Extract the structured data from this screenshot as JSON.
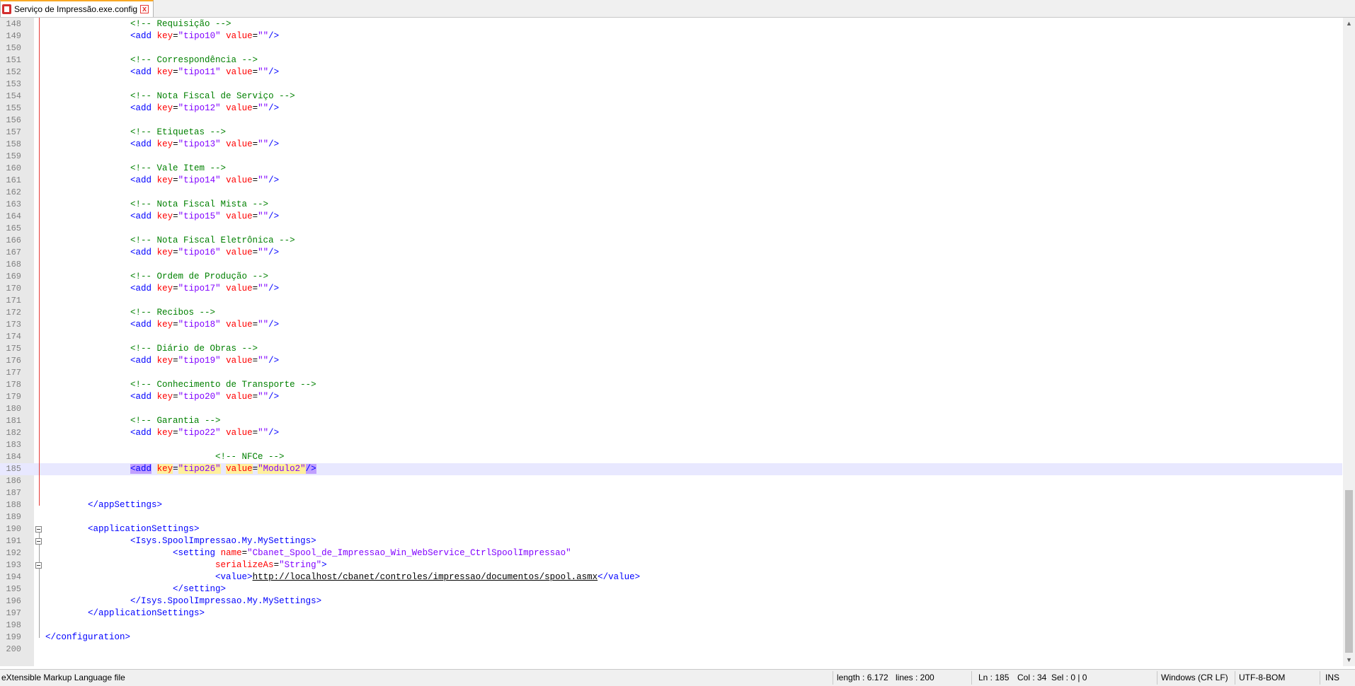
{
  "tab": {
    "title": "Serviço de Impressão.exe.config",
    "close_label": "x"
  },
  "editor": {
    "lines": [
      {
        "n": "148",
        "html": "    <span class='c-comment'>&lt;!-- Requisição --&gt;</span>"
      },
      {
        "n": "149",
        "html": "    <span class='c-tag'>&lt;add</span> <span class='c-attr'>key</span><span class='c-text'>=</span><span class='c-val'>\"tipo10\"</span> <span class='c-attr'>value</span><span class='c-text'>=</span><span class='c-val'>\"\"</span><span class='c-tag'>/&gt;</span>"
      },
      {
        "n": "150",
        "html": ""
      },
      {
        "n": "151",
        "html": "    <span class='c-comment'>&lt;!-- Correspondência --&gt;</span>"
      },
      {
        "n": "152",
        "html": "    <span class='c-tag'>&lt;add</span> <span class='c-attr'>key</span><span class='c-text'>=</span><span class='c-val'>\"tipo11\"</span> <span class='c-attr'>value</span><span class='c-text'>=</span><span class='c-val'>\"\"</span><span class='c-tag'>/&gt;</span>"
      },
      {
        "n": "153",
        "html": ""
      },
      {
        "n": "154",
        "html": "    <span class='c-comment'>&lt;!-- Nota Fiscal de Serviço --&gt;</span>"
      },
      {
        "n": "155",
        "html": "    <span class='c-tag'>&lt;add</span> <span class='c-attr'>key</span><span class='c-text'>=</span><span class='c-val'>\"tipo12\"</span> <span class='c-attr'>value</span><span class='c-text'>=</span><span class='c-val'>\"\"</span><span class='c-tag'>/&gt;</span>"
      },
      {
        "n": "156",
        "html": ""
      },
      {
        "n": "157",
        "html": "    <span class='c-comment'>&lt;!-- Etiquetas --&gt;</span>"
      },
      {
        "n": "158",
        "html": "    <span class='c-tag'>&lt;add</span> <span class='c-attr'>key</span><span class='c-text'>=</span><span class='c-val'>\"tipo13\"</span> <span class='c-attr'>value</span><span class='c-text'>=</span><span class='c-val'>\"\"</span><span class='c-tag'>/&gt;</span>"
      },
      {
        "n": "159",
        "html": ""
      },
      {
        "n": "160",
        "html": "    <span class='c-comment'>&lt;!-- Vale Item --&gt;</span>"
      },
      {
        "n": "161",
        "html": "    <span class='c-tag'>&lt;add</span> <span class='c-attr'>key</span><span class='c-text'>=</span><span class='c-val'>\"tipo14\"</span> <span class='c-attr'>value</span><span class='c-text'>=</span><span class='c-val'>\"\"</span><span class='c-tag'>/&gt;</span>"
      },
      {
        "n": "162",
        "html": ""
      },
      {
        "n": "163",
        "html": "    <span class='c-comment'>&lt;!-- Nota Fiscal Mista --&gt;</span>"
      },
      {
        "n": "164",
        "html": "    <span class='c-tag'>&lt;add</span> <span class='c-attr'>key</span><span class='c-text'>=</span><span class='c-val'>\"tipo15\"</span> <span class='c-attr'>value</span><span class='c-text'>=</span><span class='c-val'>\"\"</span><span class='c-tag'>/&gt;</span>"
      },
      {
        "n": "165",
        "html": ""
      },
      {
        "n": "166",
        "html": "    <span class='c-comment'>&lt;!-- Nota Fiscal Eletrônica --&gt;</span>"
      },
      {
        "n": "167",
        "html": "    <span class='c-tag'>&lt;add</span> <span class='c-attr'>key</span><span class='c-text'>=</span><span class='c-val'>\"tipo16\"</span> <span class='c-attr'>value</span><span class='c-text'>=</span><span class='c-val'>\"\"</span><span class='c-tag'>/&gt;</span>"
      },
      {
        "n": "168",
        "html": ""
      },
      {
        "n": "169",
        "html": "    <span class='c-comment'>&lt;!-- Ordem de Produção --&gt;</span>"
      },
      {
        "n": "170",
        "html": "    <span class='c-tag'>&lt;add</span> <span class='c-attr'>key</span><span class='c-text'>=</span><span class='c-val'>\"tipo17\"</span> <span class='c-attr'>value</span><span class='c-text'>=</span><span class='c-val'>\"\"</span><span class='c-tag'>/&gt;</span>"
      },
      {
        "n": "171",
        "html": ""
      },
      {
        "n": "172",
        "html": "    <span class='c-comment'>&lt;!-- Recibos --&gt;</span>"
      },
      {
        "n": "173",
        "html": "    <span class='c-tag'>&lt;add</span> <span class='c-attr'>key</span><span class='c-text'>=</span><span class='c-val'>\"tipo18\"</span> <span class='c-attr'>value</span><span class='c-text'>=</span><span class='c-val'>\"\"</span><span class='c-tag'>/&gt;</span>"
      },
      {
        "n": "174",
        "html": ""
      },
      {
        "n": "175",
        "html": "    <span class='c-comment'>&lt;!-- Diário de Obras --&gt;</span>"
      },
      {
        "n": "176",
        "html": "    <span class='c-tag'>&lt;add</span> <span class='c-attr'>key</span><span class='c-text'>=</span><span class='c-val'>\"tipo19\"</span> <span class='c-attr'>value</span><span class='c-text'>=</span><span class='c-val'>\"\"</span><span class='c-tag'>/&gt;</span>"
      },
      {
        "n": "177",
        "html": ""
      },
      {
        "n": "178",
        "html": "    <span class='c-comment'>&lt;!-- Conhecimento de Transporte --&gt;</span>"
      },
      {
        "n": "179",
        "html": "    <span class='c-tag'>&lt;add</span> <span class='c-attr'>key</span><span class='c-text'>=</span><span class='c-val'>\"tipo20\"</span> <span class='c-attr'>value</span><span class='c-text'>=</span><span class='c-val'>\"\"</span><span class='c-tag'>/&gt;</span>"
      },
      {
        "n": "180",
        "html": ""
      },
      {
        "n": "181",
        "html": "    <span class='c-comment'>&lt;!-- Garantia --&gt;</span>"
      },
      {
        "n": "182",
        "html": "    <span class='c-tag'>&lt;add</span> <span class='c-attr'>key</span><span class='c-text'>=</span><span class='c-val'>\"tipo22\"</span> <span class='c-attr'>value</span><span class='c-text'>=</span><span class='c-val'>\"\"</span><span class='c-tag'>/&gt;</span>"
      },
      {
        "n": "183",
        "html": ""
      },
      {
        "n": "184",
        "html": "        <span class='c-comment'>&lt;!-- NFCe --&gt;</span>"
      },
      {
        "n": "185",
        "html": "    <span class='c-tag hl-tag'>&lt;add</span> <span class='c-attr hl-attr'>key</span><span class='c-text'>=</span><span class='c-val hl-attr'>\"tipo26\"</span> <span class='c-attr hl-attr'>value</span><span class='c-text'>=</span><span class='c-val hl-attr'>\"Modulo2\"</span><span class='c-tag hl-tag'>/&gt;</span>",
        "current": true
      },
      {
        "n": "186",
        "html": ""
      },
      {
        "n": "187",
        "html": ""
      },
      {
        "n": "188",
        "html": "  <span class='c-tag'>&lt;/appSettings&gt;</span>"
      },
      {
        "n": "189",
        "html": ""
      },
      {
        "n": "190",
        "html": "  <span class='c-tag'>&lt;applicationSettings&gt;</span>"
      },
      {
        "n": "191",
        "html": "    <span class='c-tag'>&lt;Isys.SpoolImpressao.My.MySettings&gt;</span>"
      },
      {
        "n": "192",
        "html": "      <span class='c-tag'>&lt;setting</span> <span class='c-attr'>name</span><span class='c-text'>=</span><span class='c-val'>\"Cbanet_Spool_de_Impressao_Win_WebService_CtrlSpoolImpressao\"</span>"
      },
      {
        "n": "193",
        "html": "        <span class='c-attr'>serializeAs</span><span class='c-text'>=</span><span class='c-val'>\"String\"</span><span class='c-tag'>&gt;</span>"
      },
      {
        "n": "194",
        "html": "        <span class='c-tag'>&lt;value&gt;</span><span class='c-url'>http://localhost/cbanet/controles/impressao/documentos/spool.asmx</span><span class='c-tag'>&lt;/value&gt;</span>"
      },
      {
        "n": "195",
        "html": "      <span class='c-tag'>&lt;/setting&gt;</span>"
      },
      {
        "n": "196",
        "html": "    <span class='c-tag'>&lt;/Isys.SpoolImpressao.My.MySettings&gt;</span>"
      },
      {
        "n": "197",
        "html": "  <span class='c-tag'>&lt;/applicationSettings&gt;</span>"
      },
      {
        "n": "198",
        "html": ""
      },
      {
        "n": "199",
        "html": "<span class='c-tag'>&lt;/configuration&gt;</span>"
      },
      {
        "n": "200",
        "html": ""
      }
    ]
  },
  "status": {
    "file_type": "eXtensible Markup Language file",
    "length": "length : 6.172",
    "lines": "lines : 200",
    "ln": "Ln : 185",
    "col": "Col : 34",
    "sel": "Sel : 0 | 0",
    "eol": "Windows (CR LF)",
    "encoding": "UTF-8-BOM",
    "mode": "INS"
  },
  "colors": {
    "comment": "#008000",
    "tag": "#0000ff",
    "attribute": "#ff0000",
    "value": "#8000ff",
    "current_line": "#e8e8ff",
    "tab_accent": "#f9a825"
  }
}
